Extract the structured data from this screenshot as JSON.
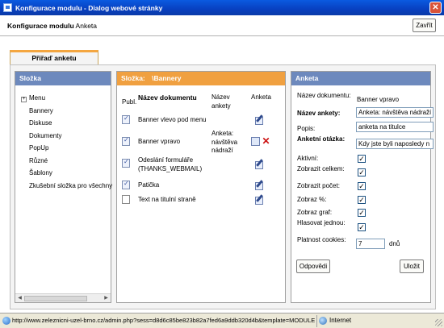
{
  "window": {
    "title": "Konfigurace modulu - Dialog webové stránky"
  },
  "header": {
    "title_prefix": "Konfigurace modulu",
    "title_module": "Anketa",
    "close_label": "Zavřít"
  },
  "tab": {
    "label": "Přiřaď anketu"
  },
  "folders": {
    "header": "Složka",
    "root": "Menu",
    "items": [
      "Bannery",
      "Diskuse",
      "Dokumenty",
      "PopUp",
      "Různé",
      "Šablony",
      "Zkušební složka pro všechny"
    ]
  },
  "documents": {
    "header_label": "Složka:",
    "header_folder": "\\Bannery",
    "columns": {
      "publ": "Publ.",
      "name": "Název dokumentu",
      "poll_name": "Název ankety",
      "poll": "Anketa"
    },
    "rows": [
      {
        "name": "Banner vlevo pod menu",
        "poll_name": ""
      },
      {
        "name": "Banner vpravo",
        "poll_name": "Anketa: návštěva nádraží"
      },
      {
        "name": "Odeslání formuláře (THANKS_WEBMAIL)",
        "poll_name": ""
      },
      {
        "name": "Patička",
        "poll_name": ""
      },
      {
        "name": "Text na titulní straně",
        "poll_name": ""
      }
    ]
  },
  "poll": {
    "header": "Anketa",
    "doc_label": "Název dokumentu:",
    "doc_value": "Banner vpravo",
    "name_label": "Název ankety:",
    "name_value": "Anketa: návštěva nádraží",
    "desc_label": "Popis:",
    "desc_value": "anketa na titulce",
    "question_label": "Anketní otázka:",
    "question_value": "Kdy jste byli naposledy n",
    "active_label": "Aktivní:",
    "show_total_label": "Zobrazit celkem:",
    "show_count_label": "Zobrazit počet:",
    "show_pct_label": "Zobraz %:",
    "show_graph_label": "Zobraz graf:",
    "vote_once_label": "Hlasovat jednou:",
    "cookie_label": "Platnost cookies:",
    "cookie_value": "7",
    "cookie_unit": "dnů",
    "answers_button": "Odpovědi",
    "save_button": "Uložit"
  },
  "status": {
    "url": "http://www.zeleznicni-uzel-brno.cz/admin.php?sess=d8d6c85be823b82a7fed6a9ddb320d4b&template=MODULE",
    "zone": "Internet"
  }
}
